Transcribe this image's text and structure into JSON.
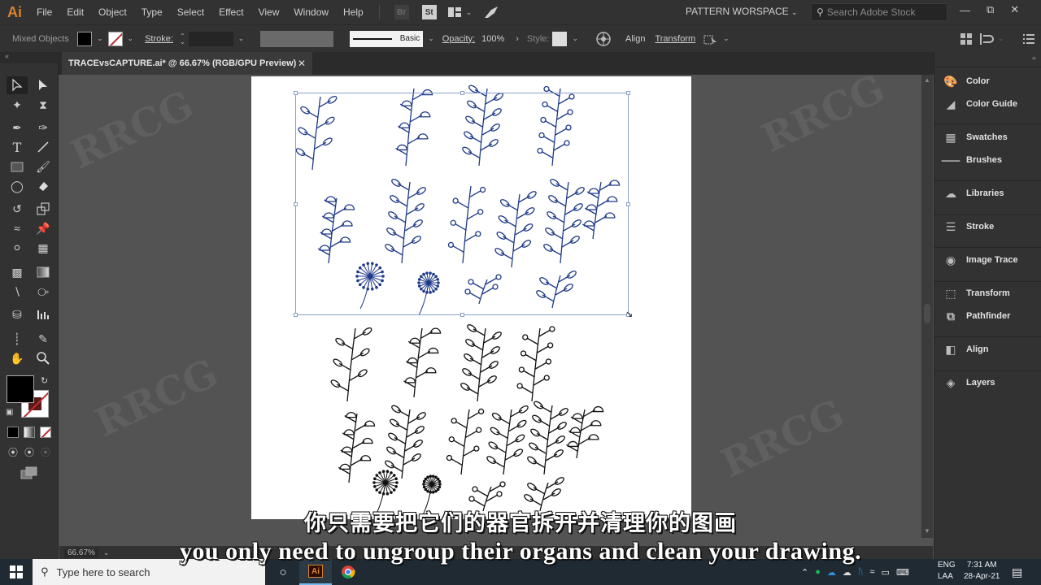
{
  "menubar": {
    "app_logo": "Ai",
    "items": [
      "File",
      "Edit",
      "Object",
      "Type",
      "Select",
      "Effect",
      "View",
      "Window",
      "Help"
    ],
    "bridge_label": "Br",
    "stock_label": "St",
    "workspace": "PATTERN WORSPACE",
    "stock_search_placeholder": "Search Adobe Stock"
  },
  "controlbar": {
    "selection_type": "Mixed Objects",
    "fill_color": "#000000",
    "stroke_label": "Stroke:",
    "stroke_weight": "",
    "brush_label": "Basic",
    "opacity_label": "Opacity:",
    "opacity_value": "100%",
    "style_label": "Style:",
    "align_label": "Align",
    "transform_label": "Transform"
  },
  "document": {
    "tab_title": "TRACEvsCAPTURE.ai* @ 66.67% (RGB/GPU Preview)",
    "zoom_level": "66.67%",
    "selection_color": "#8aa0c8",
    "traced_art_color": "#1e3a8a",
    "original_art_color": "#111111"
  },
  "tools": [
    "selection-tool",
    "direct-selection-tool",
    "magic-wand-tool",
    "lasso-tool",
    "pen-tool",
    "curvature-tool",
    "type-tool",
    "line-segment-tool",
    "rectangle-tool",
    "paintbrush-tool",
    "shaper-tool",
    "eraser-tool",
    "rotate-tool",
    "scale-tool",
    "puppet-warp-tool",
    "pin-tool",
    "shape-builder-tool",
    "perspective-grid-tool",
    "mesh-tool",
    "gradient-tool",
    "eyedropper-tool",
    "blend-tool",
    "symbol-sprayer-tool",
    "column-graph-tool",
    "artboard-tool",
    "slice-tool",
    "hand-tool",
    "zoom-tool"
  ],
  "panels": [
    {
      "label": "Color",
      "icon": "palette-icon"
    },
    {
      "label": "Color Guide",
      "icon": "color-guide-icon"
    },
    {
      "label": "Swatches",
      "icon": "swatches-icon"
    },
    {
      "label": "Brushes",
      "icon": "brushes-icon"
    },
    {
      "label": "Libraries",
      "icon": "creative-cloud-icon"
    },
    {
      "label": "Stroke",
      "icon": "stroke-icon"
    },
    {
      "label": "Image Trace",
      "icon": "image-trace-icon"
    },
    {
      "label": "Transform",
      "icon": "transform-icon"
    },
    {
      "label": "Pathfinder",
      "icon": "pathfinder-icon"
    },
    {
      "label": "Align",
      "icon": "align-icon"
    },
    {
      "label": "Layers",
      "icon": "layers-icon"
    }
  ],
  "subtitles": {
    "chinese": "你只需要把它们的器官拆开并清理你的图画",
    "english": "you only need to ungroup their organs and clean your drawing."
  },
  "taskbar": {
    "search_placeholder": "Type here to search",
    "language_top": "ENG",
    "language_bottom": "LAA",
    "time": "7:31 AM",
    "date": "28-Apr-21"
  },
  "watermark": "RRCG"
}
